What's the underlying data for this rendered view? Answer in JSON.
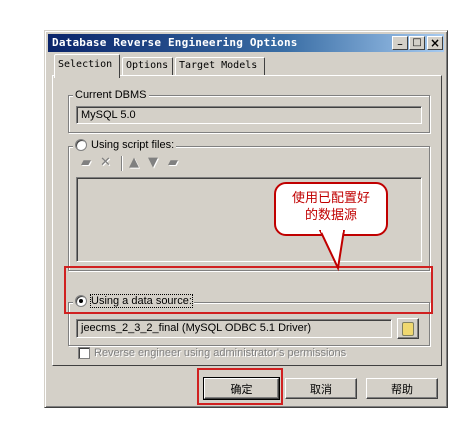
{
  "window": {
    "title": "Database Reverse Engineering Options",
    "controls": {
      "minimize": "_",
      "maximize": "□",
      "close": "×"
    }
  },
  "tabs": [
    {
      "label": "Selection",
      "active": true
    },
    {
      "label": "Options",
      "active": false
    },
    {
      "label": "Target Models",
      "active": false
    }
  ],
  "current_dbms": {
    "legend": "Current DBMS",
    "value": "MySQL 5.0"
  },
  "script_files": {
    "label": "Using script files:",
    "selected": false,
    "toolbar_icons": [
      "add-file-icon",
      "delete-icon",
      "move-up-icon",
      "move-down-icon",
      "folder-icon"
    ]
  },
  "data_source": {
    "label": "Using a data source:",
    "selected": true,
    "value": "jeecms_2_3_2_final (MySQL ODBC 5.1 Driver)"
  },
  "admin_permissions": {
    "label": "Reverse engineer using administrator's permissions",
    "checked": false
  },
  "annotation": {
    "text_line1": "使用已配置好",
    "text_line2": "的数据源",
    "color": "#c00000"
  },
  "buttons": {
    "ok": "确定",
    "cancel": "取消",
    "help": "帮助"
  }
}
